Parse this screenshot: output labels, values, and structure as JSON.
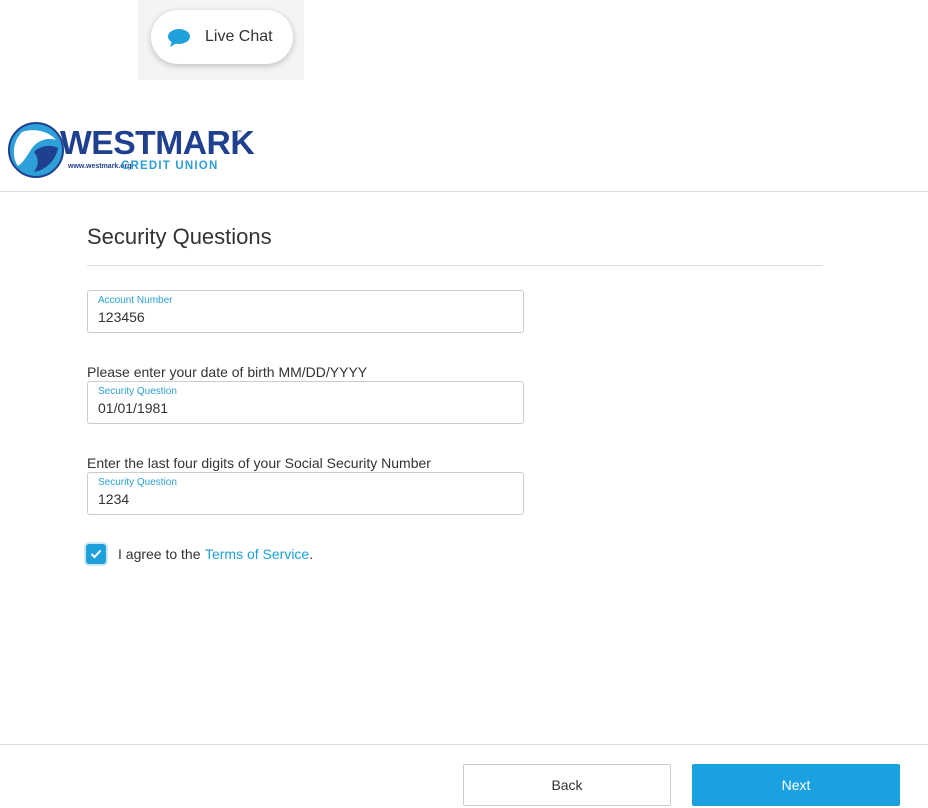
{
  "chat": {
    "label": "Live Chat",
    "icon": "speech-bubble-icon",
    "icon_color": "#1ea0dc"
  },
  "logo": {
    "brand": "WESTMARK",
    "trademark": "™",
    "url": "www.westmark.org",
    "subtitle": "CREDIT UNION",
    "brand_color": "#1f3f8f",
    "accent_color": "#2d9fd9"
  },
  "page": {
    "title": "Security Questions"
  },
  "fields": [
    {
      "label": "Account Number",
      "value": "123456"
    },
    {
      "question": "Please enter your date of birth MM/DD/YYYY",
      "label": "Security Question",
      "value": "01/01/1981"
    },
    {
      "question": "Enter the last four digits of your Social Security Number",
      "label": "Security Question",
      "value": "1234"
    }
  ],
  "agree": {
    "checked": true,
    "prefix": "I agree to the",
    "link": "Terms of Service",
    "suffix": "."
  },
  "buttons": {
    "back": "Back",
    "next": "Next"
  },
  "colors": {
    "accent": "#1ba1e2",
    "label": "#2b9fd6",
    "text": "#333333"
  }
}
